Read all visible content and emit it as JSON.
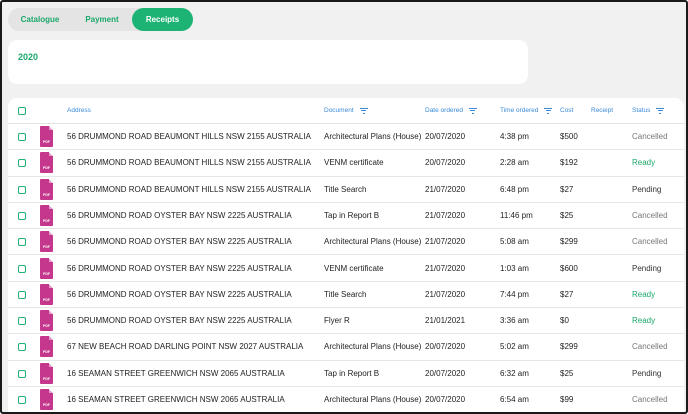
{
  "tabs": [
    {
      "label": "Catalogue",
      "active": false
    },
    {
      "label": "Payment",
      "active": false
    },
    {
      "label": "Receipts",
      "active": true
    }
  ],
  "year": "2020",
  "columns": {
    "address": "Address",
    "document": "Document",
    "date_ordered": "Date ordered",
    "time_ordered": "Time ordered",
    "cost": "Cost",
    "receipt": "Receipt",
    "status": "Status"
  },
  "file_icon_label": "PDF",
  "colors": {
    "accent": "#1db374",
    "header_text": "#3b8ad8",
    "pdf_icon": "#c4378d",
    "status_ready": "#1aa86a",
    "status_cancelled": "#777777"
  },
  "rows": [
    {
      "address": "56 DRUMMOND ROAD BEAUMONT HILLS NSW 2155 AUSTRALIA",
      "document": "Architectural Plans (House)",
      "date": "20/07/2020",
      "time": "4:38 pm",
      "cost": "$500",
      "status": "Cancelled"
    },
    {
      "address": "56 DRUMMOND ROAD BEAUMONT HILLS NSW 2155 AUSTRALIA",
      "document": "VENM certificate",
      "date": "20/07/2020",
      "time": "2:28 am",
      "cost": "$192",
      "status": "Ready"
    },
    {
      "address": "56 DRUMMOND ROAD BEAUMONT HILLS NSW 2155 AUSTRALIA",
      "document": "Title Search",
      "date": "21/07/2020",
      "time": "6:48 pm",
      "cost": "$27",
      "status": "Pending"
    },
    {
      "address": "56 DRUMMOND ROAD OYSTER BAY NSW 2225 AUSTRALIA",
      "document": "Tap in Report B",
      "date": "21/07/2020",
      "time": "11:46 pm",
      "cost": "$25",
      "status": "Cancelled"
    },
    {
      "address": "56 DRUMMOND ROAD OYSTER BAY NSW 2225 AUSTRALIA",
      "document": "Architectural Plans (House)",
      "date": "21/07/2020",
      "time": "5:08 am",
      "cost": "$299",
      "status": "Cancelled"
    },
    {
      "address": "56 DRUMMOND ROAD OYSTER BAY NSW 2225 AUSTRALIA",
      "document": "VENM certificate",
      "date": "21/07/2020",
      "time": "1:03 am",
      "cost": "$600",
      "status": "Pending"
    },
    {
      "address": "56 DRUMMOND ROAD OYSTER BAY NSW 2225 AUSTRALIA",
      "document": "Title Search",
      "date": "21/07/2020",
      "time": "7:44 pm",
      "cost": "$27",
      "status": "Ready"
    },
    {
      "address": "56 DRUMMOND ROAD OYSTER BAY NSW 2225 AUSTRALIA",
      "document": "Flyer R",
      "date": "21/01/2021",
      "time": "3:36 am",
      "cost": "$0",
      "status": "Ready"
    },
    {
      "address": "67 NEW BEACH ROAD DARLING POINT NSW 2027 AUSTRALIA",
      "document": "Architectural Plans (House)",
      "date": "20/07/2020",
      "time": "5:02 am",
      "cost": "$299",
      "status": "Cancelled"
    },
    {
      "address": "16 SEAMAN STREET GREENWICH NSW 2065 AUSTRALIA",
      "document": "Tap in Report B",
      "date": "20/07/2020",
      "time": "6:32 am",
      "cost": "$25",
      "status": "Pending"
    },
    {
      "address": "16 SEAMAN STREET GREENWICH NSW 2065 AUSTRALIA",
      "document": "Architectural Plans (House)",
      "date": "20/07/2020",
      "time": "6:54 am",
      "cost": "$99",
      "status": "Cancelled"
    }
  ]
}
